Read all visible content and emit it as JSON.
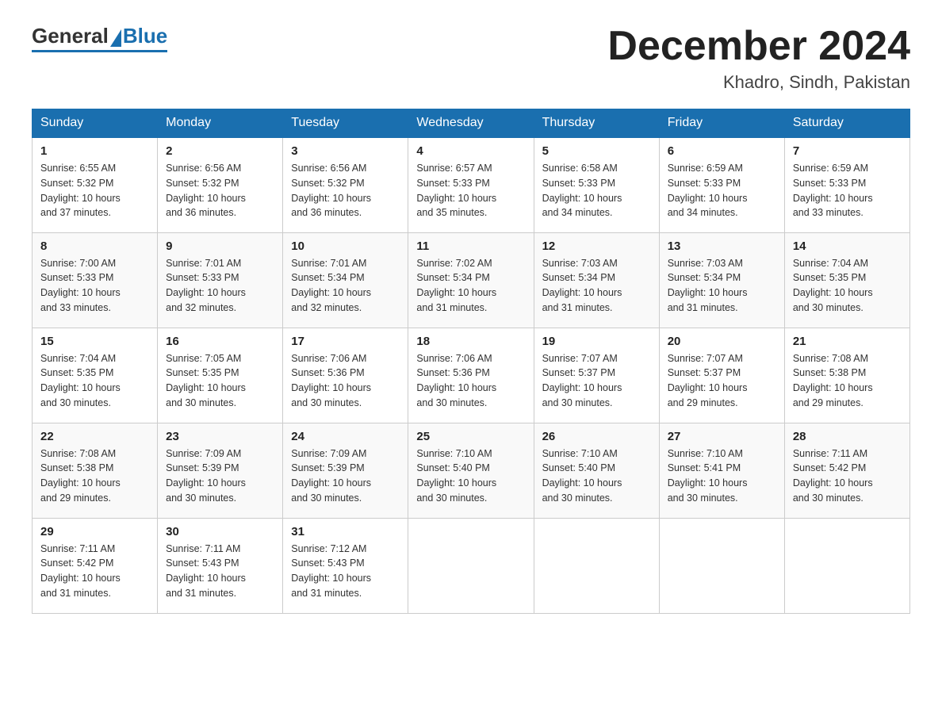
{
  "header": {
    "logo_general": "General",
    "logo_blue": "Blue",
    "month_title": "December 2024",
    "location": "Khadro, Sindh, Pakistan"
  },
  "weekdays": [
    "Sunday",
    "Monday",
    "Tuesday",
    "Wednesday",
    "Thursday",
    "Friday",
    "Saturday"
  ],
  "weeks": [
    [
      {
        "day": "1",
        "sunrise": "6:55 AM",
        "sunset": "5:32 PM",
        "daylight": "10 hours and 37 minutes."
      },
      {
        "day": "2",
        "sunrise": "6:56 AM",
        "sunset": "5:32 PM",
        "daylight": "10 hours and 36 minutes."
      },
      {
        "day": "3",
        "sunrise": "6:56 AM",
        "sunset": "5:32 PM",
        "daylight": "10 hours and 36 minutes."
      },
      {
        "day": "4",
        "sunrise": "6:57 AM",
        "sunset": "5:33 PM",
        "daylight": "10 hours and 35 minutes."
      },
      {
        "day": "5",
        "sunrise": "6:58 AM",
        "sunset": "5:33 PM",
        "daylight": "10 hours and 34 minutes."
      },
      {
        "day": "6",
        "sunrise": "6:59 AM",
        "sunset": "5:33 PM",
        "daylight": "10 hours and 34 minutes."
      },
      {
        "day": "7",
        "sunrise": "6:59 AM",
        "sunset": "5:33 PM",
        "daylight": "10 hours and 33 minutes."
      }
    ],
    [
      {
        "day": "8",
        "sunrise": "7:00 AM",
        "sunset": "5:33 PM",
        "daylight": "10 hours and 33 minutes."
      },
      {
        "day": "9",
        "sunrise": "7:01 AM",
        "sunset": "5:33 PM",
        "daylight": "10 hours and 32 minutes."
      },
      {
        "day": "10",
        "sunrise": "7:01 AM",
        "sunset": "5:34 PM",
        "daylight": "10 hours and 32 minutes."
      },
      {
        "day": "11",
        "sunrise": "7:02 AM",
        "sunset": "5:34 PM",
        "daylight": "10 hours and 31 minutes."
      },
      {
        "day": "12",
        "sunrise": "7:03 AM",
        "sunset": "5:34 PM",
        "daylight": "10 hours and 31 minutes."
      },
      {
        "day": "13",
        "sunrise": "7:03 AM",
        "sunset": "5:34 PM",
        "daylight": "10 hours and 31 minutes."
      },
      {
        "day": "14",
        "sunrise": "7:04 AM",
        "sunset": "5:35 PM",
        "daylight": "10 hours and 30 minutes."
      }
    ],
    [
      {
        "day": "15",
        "sunrise": "7:04 AM",
        "sunset": "5:35 PM",
        "daylight": "10 hours and 30 minutes."
      },
      {
        "day": "16",
        "sunrise": "7:05 AM",
        "sunset": "5:35 PM",
        "daylight": "10 hours and 30 minutes."
      },
      {
        "day": "17",
        "sunrise": "7:06 AM",
        "sunset": "5:36 PM",
        "daylight": "10 hours and 30 minutes."
      },
      {
        "day": "18",
        "sunrise": "7:06 AM",
        "sunset": "5:36 PM",
        "daylight": "10 hours and 30 minutes."
      },
      {
        "day": "19",
        "sunrise": "7:07 AM",
        "sunset": "5:37 PM",
        "daylight": "10 hours and 30 minutes."
      },
      {
        "day": "20",
        "sunrise": "7:07 AM",
        "sunset": "5:37 PM",
        "daylight": "10 hours and 29 minutes."
      },
      {
        "day": "21",
        "sunrise": "7:08 AM",
        "sunset": "5:38 PM",
        "daylight": "10 hours and 29 minutes."
      }
    ],
    [
      {
        "day": "22",
        "sunrise": "7:08 AM",
        "sunset": "5:38 PM",
        "daylight": "10 hours and 29 minutes."
      },
      {
        "day": "23",
        "sunrise": "7:09 AM",
        "sunset": "5:39 PM",
        "daylight": "10 hours and 30 minutes."
      },
      {
        "day": "24",
        "sunrise": "7:09 AM",
        "sunset": "5:39 PM",
        "daylight": "10 hours and 30 minutes."
      },
      {
        "day": "25",
        "sunrise": "7:10 AM",
        "sunset": "5:40 PM",
        "daylight": "10 hours and 30 minutes."
      },
      {
        "day": "26",
        "sunrise": "7:10 AM",
        "sunset": "5:40 PM",
        "daylight": "10 hours and 30 minutes."
      },
      {
        "day": "27",
        "sunrise": "7:10 AM",
        "sunset": "5:41 PM",
        "daylight": "10 hours and 30 minutes."
      },
      {
        "day": "28",
        "sunrise": "7:11 AM",
        "sunset": "5:42 PM",
        "daylight": "10 hours and 30 minutes."
      }
    ],
    [
      {
        "day": "29",
        "sunrise": "7:11 AM",
        "sunset": "5:42 PM",
        "daylight": "10 hours and 31 minutes."
      },
      {
        "day": "30",
        "sunrise": "7:11 AM",
        "sunset": "5:43 PM",
        "daylight": "10 hours and 31 minutes."
      },
      {
        "day": "31",
        "sunrise": "7:12 AM",
        "sunset": "5:43 PM",
        "daylight": "10 hours and 31 minutes."
      },
      null,
      null,
      null,
      null
    ]
  ],
  "labels": {
    "sunrise": "Sunrise:",
    "sunset": "Sunset:",
    "daylight": "Daylight:"
  }
}
